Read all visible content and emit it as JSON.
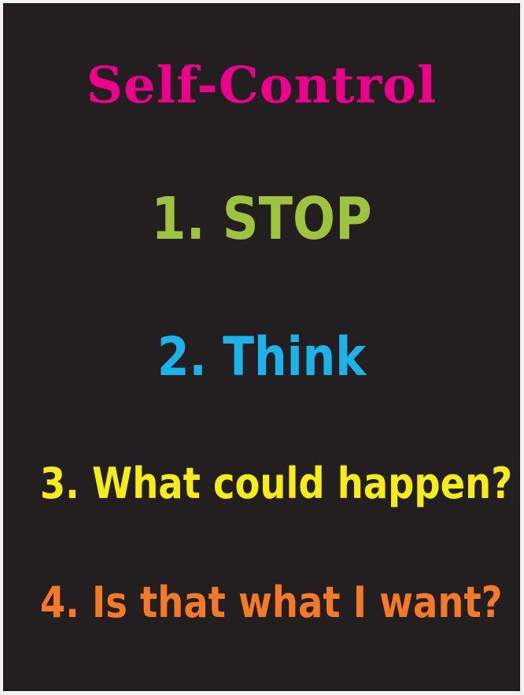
{
  "poster": {
    "title": "Self-Control",
    "steps": [
      {
        "text": "1. STOP"
      },
      {
        "text": "2. Think"
      },
      {
        "text": "3. What could happen?"
      },
      {
        "text": "4. Is that what I want?"
      }
    ]
  },
  "colors": {
    "background": "#231f20",
    "title": "#ec008c",
    "step1": "#9dc43c",
    "step2": "#1cb3e8",
    "step3": "#f6ec16",
    "step4": "#f47a27"
  }
}
